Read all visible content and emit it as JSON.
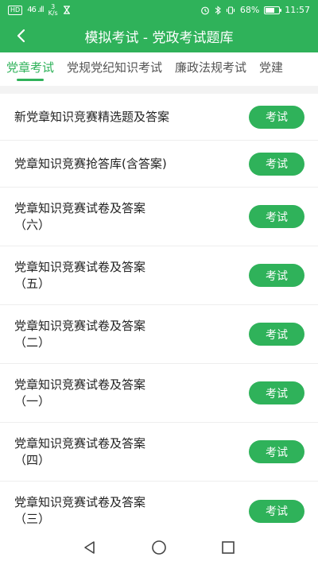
{
  "status_bar": {
    "hd": "HD",
    "signal": "46 .ıll",
    "speed_value": "3",
    "speed_unit": "K/s",
    "battery": "68%",
    "battery_level": 0.68,
    "time": "11:57"
  },
  "app_bar": {
    "title": "模拟考试 - 党政考试题库"
  },
  "tabs": [
    {
      "label": "党章考试",
      "active": true
    },
    {
      "label": "党规党纪知识考试",
      "active": false
    },
    {
      "label": "廉政法规考试",
      "active": false
    },
    {
      "label": "党建",
      "active": false
    }
  ],
  "list": [
    {
      "line1": "新党章知识竞赛精选题及答案",
      "line2": "",
      "button": "考试"
    },
    {
      "line1": "党章知识竞赛抢答库(含答案)",
      "line2": "",
      "button": "考试"
    },
    {
      "line1": "党章知识竞赛试卷及答案",
      "line2": "（六）",
      "button": "考试"
    },
    {
      "line1": "党章知识竞赛试卷及答案",
      "line2": "（五）",
      "button": "考试"
    },
    {
      "line1": "党章知识竞赛试卷及答案",
      "line2": "（二）",
      "button": "考试"
    },
    {
      "line1": "党章知识竞赛试卷及答案",
      "line2": "（一）",
      "button": "考试"
    },
    {
      "line1": "党章知识竞赛试卷及答案",
      "line2": "（四）",
      "button": "考试"
    },
    {
      "line1": "党章知识竞赛试卷及答案",
      "line2": "（三）",
      "button": "考试"
    }
  ],
  "colors": {
    "brand": "#2fb25a",
    "text": "#222222",
    "tab_inactive": "#555555"
  },
  "icons": {
    "back": "chevron-left-icon",
    "nav_back": "triangle-back-icon",
    "nav_home": "circle-home-icon",
    "nav_recent": "square-recent-icon"
  }
}
